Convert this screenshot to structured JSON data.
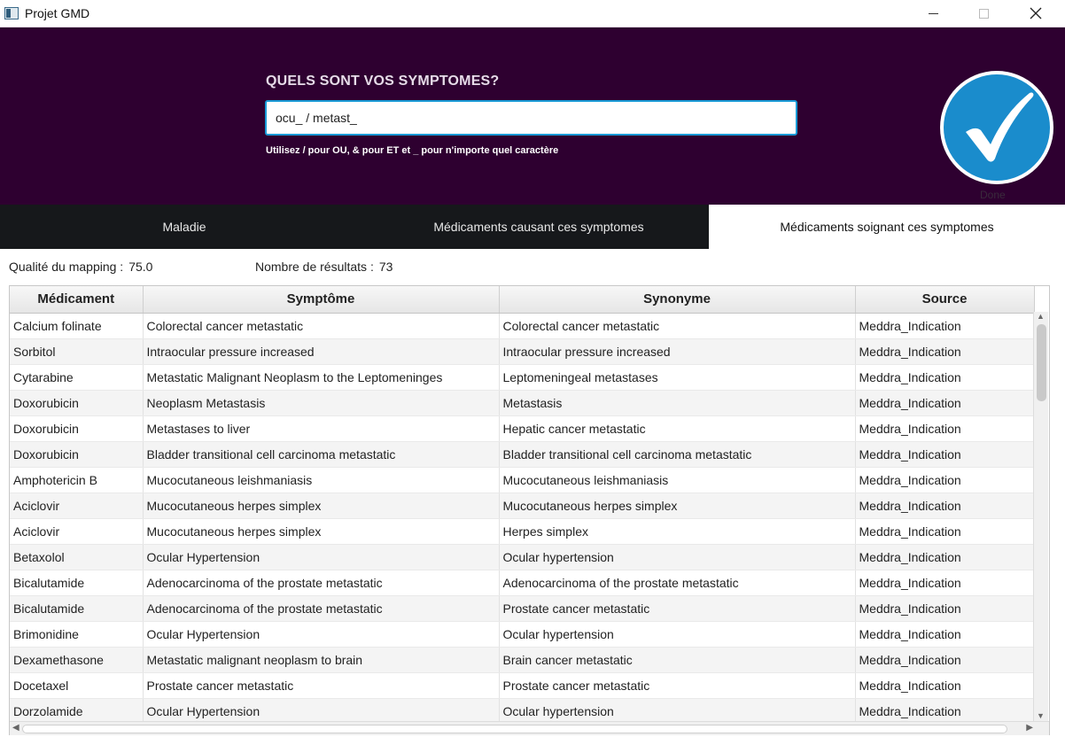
{
  "window": {
    "title": "Projet GMD"
  },
  "header": {
    "question": "QUELS SONT VOS SYMPTOMES?",
    "search_value": "ocu_ / metast_",
    "hint": "Utilisez / pour OU, & pour ET et _ pour n'importe quel caractère",
    "done_label": "Done",
    "done_icon": "checkmark-icon",
    "accent": "#1a8ccc",
    "background": "#2e0030"
  },
  "tabs": [
    {
      "label": "Maladie",
      "selected": false
    },
    {
      "label": "Médicaments causant ces symptomes",
      "selected": false
    },
    {
      "label": "Médicaments soignant ces symptomes",
      "selected": true
    }
  ],
  "stats": {
    "mapping_label": "Qualité du mapping :",
    "mapping_value": "75.0",
    "results_label": "Nombre de résultats :",
    "results_value": "73"
  },
  "table": {
    "columns": [
      "Médicament",
      "Symptôme",
      "Synonyme",
      "Source"
    ],
    "rows": [
      [
        "Calcium folinate",
        "Colorectal cancer metastatic",
        "Colorectal cancer metastatic",
        "Meddra_Indication"
      ],
      [
        "Sorbitol",
        "Intraocular pressure increased",
        "Intraocular pressure increased",
        "Meddra_Indication"
      ],
      [
        "Cytarabine",
        "Metastatic Malignant Neoplasm to the Leptomeninges",
        "Leptomeningeal metastases",
        "Meddra_Indication"
      ],
      [
        "Doxorubicin",
        "Neoplasm Metastasis",
        "Metastasis",
        "Meddra_Indication"
      ],
      [
        "Doxorubicin",
        "Metastases to liver",
        "Hepatic cancer metastatic",
        "Meddra_Indication"
      ],
      [
        "Doxorubicin",
        "Bladder transitional cell carcinoma metastatic",
        "Bladder transitional cell carcinoma metastatic",
        "Meddra_Indication"
      ],
      [
        "Amphotericin B",
        "Mucocutaneous leishmaniasis",
        "Mucocutaneous leishmaniasis",
        "Meddra_Indication"
      ],
      [
        "Aciclovir",
        "Mucocutaneous herpes simplex",
        "Mucocutaneous herpes simplex",
        "Meddra_Indication"
      ],
      [
        "Aciclovir",
        "Mucocutaneous herpes simplex",
        "Herpes simplex",
        "Meddra_Indication"
      ],
      [
        "Betaxolol",
        "Ocular Hypertension",
        "Ocular hypertension",
        "Meddra_Indication"
      ],
      [
        "Bicalutamide",
        "Adenocarcinoma of the prostate metastatic",
        "Adenocarcinoma of the prostate metastatic",
        "Meddra_Indication"
      ],
      [
        "Bicalutamide",
        "Adenocarcinoma of the prostate metastatic",
        "Prostate cancer metastatic",
        "Meddra_Indication"
      ],
      [
        "Brimonidine",
        "Ocular Hypertension",
        "Ocular hypertension",
        "Meddra_Indication"
      ],
      [
        "Dexamethasone",
        "Metastatic malignant neoplasm to brain",
        "Brain cancer metastatic",
        "Meddra_Indication"
      ],
      [
        "Docetaxel",
        "Prostate cancer metastatic",
        "Prostate cancer metastatic",
        "Meddra_Indication"
      ],
      [
        "Dorzolamide",
        "Ocular Hypertension",
        "Ocular hypertension",
        "Meddra_Indication"
      ]
    ]
  }
}
